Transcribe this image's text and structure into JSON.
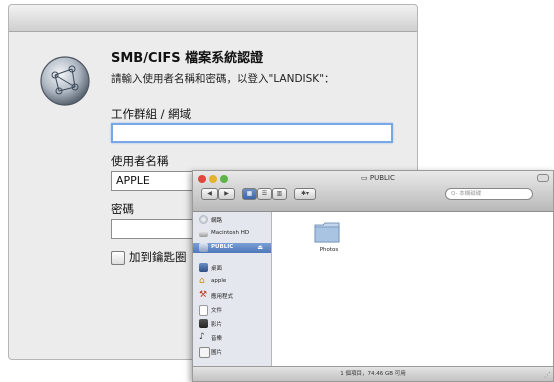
{
  "dialog": {
    "title": "SMB/CIFS 檔案系統認證",
    "message": "請輸入使用者名稱和密碼，以登入\"LANDISK\"：",
    "workgroup_label": "工作群組 / 網域",
    "workgroup_value": "",
    "username_label": "使用者名稱",
    "username_value": "APPLE",
    "password_label": "密碼",
    "password_value": "",
    "keychain_label": "加到鑰匙圈"
  },
  "finder": {
    "title": "PUBLIC",
    "search_placeholder": "Q- 本機磁碟",
    "nav_back": "◀",
    "nav_forward": "▶",
    "action_label": "✱▾",
    "sidebar": [
      {
        "label": "網路"
      },
      {
        "label": "Macintosh HD"
      },
      {
        "label": "PUBLIC",
        "selected": true
      },
      {
        "label": "桌面"
      },
      {
        "label": "apple"
      },
      {
        "label": "應用程式"
      },
      {
        "label": "文件"
      },
      {
        "label": "影片"
      },
      {
        "label": "音樂"
      },
      {
        "label": "圖片"
      }
    ],
    "items": [
      {
        "label": "Photos"
      }
    ],
    "status": "1 個項目，74.46 GB 可用",
    "eject_icon": "eject-icon"
  },
  "colors": {
    "selection": "#4f78b8",
    "focus_ring": "#78a7e6",
    "close": "#e2453c",
    "minimize": "#e5b230",
    "zoom": "#5db543"
  }
}
